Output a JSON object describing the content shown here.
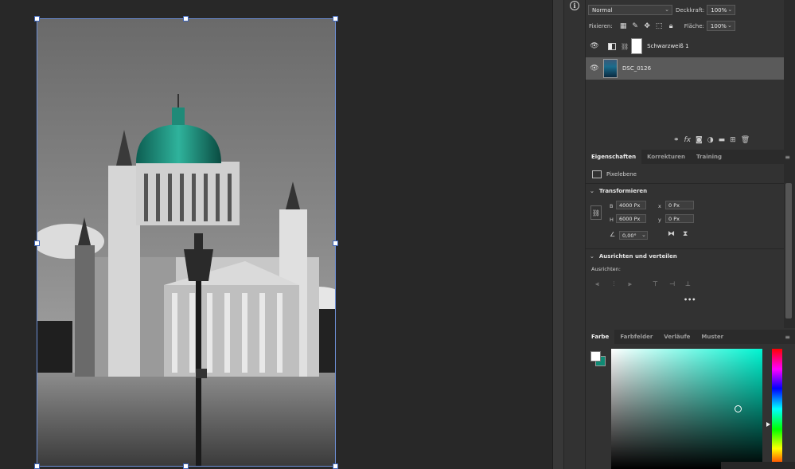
{
  "canvas": {
    "document_image": "church-photo-bw-teal-dome"
  },
  "info_button": {
    "glyph": "i"
  },
  "layers_panel": {
    "blend_mode": "Normal",
    "opacity_label": "Deckkraft:",
    "opacity_value": "100%",
    "lock_label": "Fixieren:",
    "fill_label": "Fläche:",
    "fill_value": "100%",
    "lock_icons": [
      "lock-transparent-icon",
      "lock-paint-icon",
      "lock-position-icon",
      "lock-artboard-icon",
      "lock-all-icon"
    ],
    "layers": [
      {
        "name": "Schwarzweiß 1",
        "type": "adjustment",
        "visible": true,
        "selected": false
      },
      {
        "name": "DSC_0126",
        "type": "pixel",
        "visible": true,
        "selected": true
      }
    ],
    "footer_icons": [
      "link-icon",
      "fx-icon",
      "mask-icon",
      "adjustment-icon",
      "group-icon",
      "new-layer-icon",
      "trash-icon"
    ]
  },
  "properties_panel": {
    "tabs": [
      "Eigenschaften",
      "Korrekturen",
      "Training"
    ],
    "active_tab": "Eigenschaften",
    "layer_kind": "Pixelebene",
    "transform_title": "Transformieren",
    "width_label": "B",
    "width_value": "4000 Px",
    "height_label": "H",
    "height_value": "6000 Px",
    "x_label": "x",
    "x_value": "0 Px",
    "y_label": "y",
    "y_value": "0 Px",
    "angle_value": "0,00°",
    "align_title": "Ausrichten und verteilen",
    "align_label": "Ausrichten:",
    "more": "•••"
  },
  "color_panel": {
    "tabs": [
      "Farbe",
      "Farbfelder",
      "Verläufe",
      "Muster"
    ],
    "active_tab": "Farbe",
    "foreground": "#ffffff",
    "background": "#0f8a74",
    "hue_color": "#00f5d2"
  }
}
